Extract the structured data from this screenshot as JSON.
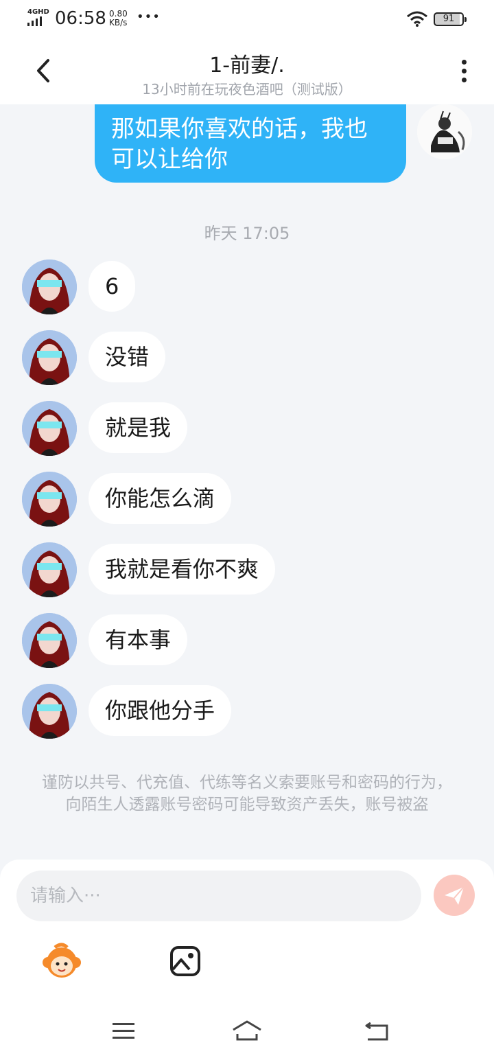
{
  "status_bar": {
    "network": "4GHD",
    "time": "06:58",
    "speed_value": "0.80",
    "speed_unit": "KB/s",
    "more": "•••",
    "battery": "91"
  },
  "header": {
    "title": "1-前妻/.",
    "subtitle": "13小时前在玩夜色酒吧（测试版）"
  },
  "messages": {
    "outgoing_text": "那如果你喜欢的话，我也可以让给你",
    "timestamp": "昨天 17:05",
    "incoming": [
      {
        "text": "6"
      },
      {
        "text": "没错"
      },
      {
        "text": "就是我"
      },
      {
        "text": "你能怎么滴"
      },
      {
        "text": "我就是看你不爽"
      },
      {
        "text": "有本事"
      },
      {
        "text": "你跟他分手"
      }
    ]
  },
  "warning": "谨防以共号、代充值、代练等名义索要账号和密码的行为，向陌生人透露账号密码可能导致资产丢失，账号被盗",
  "composer": {
    "placeholder": "请输入···",
    "value": ""
  },
  "colors": {
    "outgoing_bubble": "#2fb3f7",
    "send_button": "#fbc8c0",
    "chat_background": "#f3f5f8"
  },
  "icons": [
    "back-arrow-icon",
    "more-vertical-icon",
    "send-icon",
    "monkey-emoji-icon",
    "image-icon",
    "menu-icon",
    "home-icon",
    "return-icon"
  ]
}
